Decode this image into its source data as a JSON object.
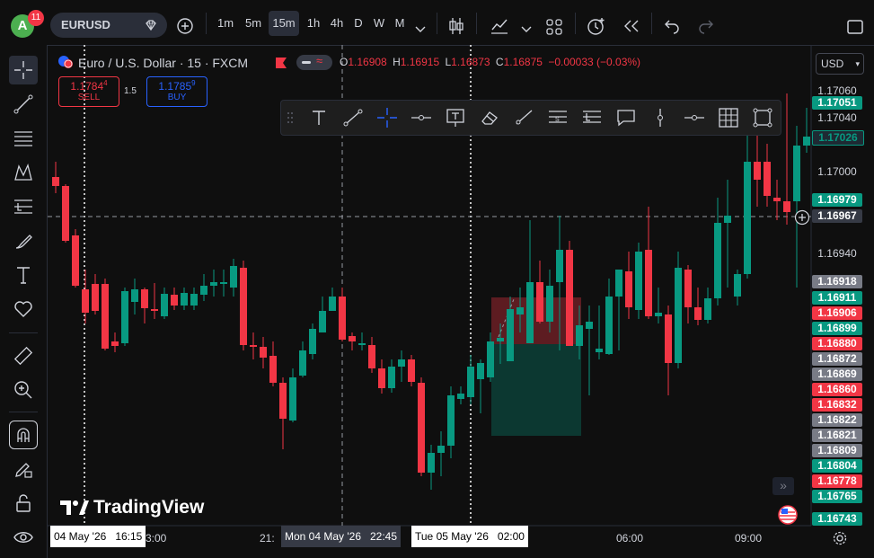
{
  "topbar": {
    "avatar_letter": "A",
    "notification_count": "11",
    "symbol": "EURUSD",
    "intervals": [
      "1m",
      "5m",
      "15m",
      "1h",
      "4h",
      "D",
      "W",
      "M"
    ],
    "active_interval": "15m"
  },
  "legend": {
    "title": "Euro / U.S. Dollar · 15 · FXCM",
    "o_label": "O",
    "o_value": "1.16908",
    "h_label": "H",
    "h_value": "1.16915",
    "l_label": "L",
    "l_value": "1.16873",
    "c_label": "C",
    "c_value": "1.16875",
    "change": "−0.00033 (−0.03%)"
  },
  "trade": {
    "sell_price": "1.1784",
    "sell_superscript": "4",
    "sell_label": "SELL",
    "spread": "1.5",
    "buy_price": "1.1785",
    "buy_superscript": "9",
    "buy_label": "BUY"
  },
  "currency": "USD",
  "price_axis": {
    "plain_labels": [
      "1.17060",
      "1.17040",
      "1.17000",
      "1.16940"
    ],
    "tags": [
      {
        "text": "1.17051",
        "color": "#089981"
      },
      {
        "text": "1.17026",
        "color": "#1e2a33"
      },
      {
        "text": "1.16979",
        "color": "#089981"
      },
      {
        "text": "1.16967",
        "color": "#363a45"
      },
      {
        "text": "1.16918",
        "color": "#787b86"
      },
      {
        "text": "1.16911",
        "color": "#089981"
      },
      {
        "text": "1.16906",
        "color": "#f23645"
      },
      {
        "text": "1.16899",
        "color": "#089981"
      },
      {
        "text": "1.16880",
        "color": "#f23645"
      },
      {
        "text": "1.16872",
        "color": "#787b86"
      },
      {
        "text": "1.16869",
        "color": "#787b86"
      },
      {
        "text": "1.16860",
        "color": "#f23645"
      },
      {
        "text": "1.16832",
        "color": "#f23645"
      },
      {
        "text": "1.16822",
        "color": "#787b86"
      },
      {
        "text": "1.16821",
        "color": "#787b86"
      },
      {
        "text": "1.16809",
        "color": "#787b86"
      },
      {
        "text": "1.16804",
        "color": "#089981"
      },
      {
        "text": "1.16778",
        "color": "#f23645"
      },
      {
        "text": "1.16765",
        "color": "#089981"
      },
      {
        "text": "1.16743",
        "color": "#089981"
      }
    ]
  },
  "time_axis": {
    "labels": [
      "3:00",
      "21:",
      "06:00",
      "09:00"
    ],
    "highlight_1": "04 May '26   16:15",
    "highlight_2": "Mon 04 May '26   22:45",
    "highlight_3": "Tue 05 May '26   02:00"
  },
  "watermark": "TradingView",
  "colors": {
    "up": "#089981",
    "down": "#f23645",
    "background": "#0f0f0f",
    "accent": "#2962ff"
  }
}
